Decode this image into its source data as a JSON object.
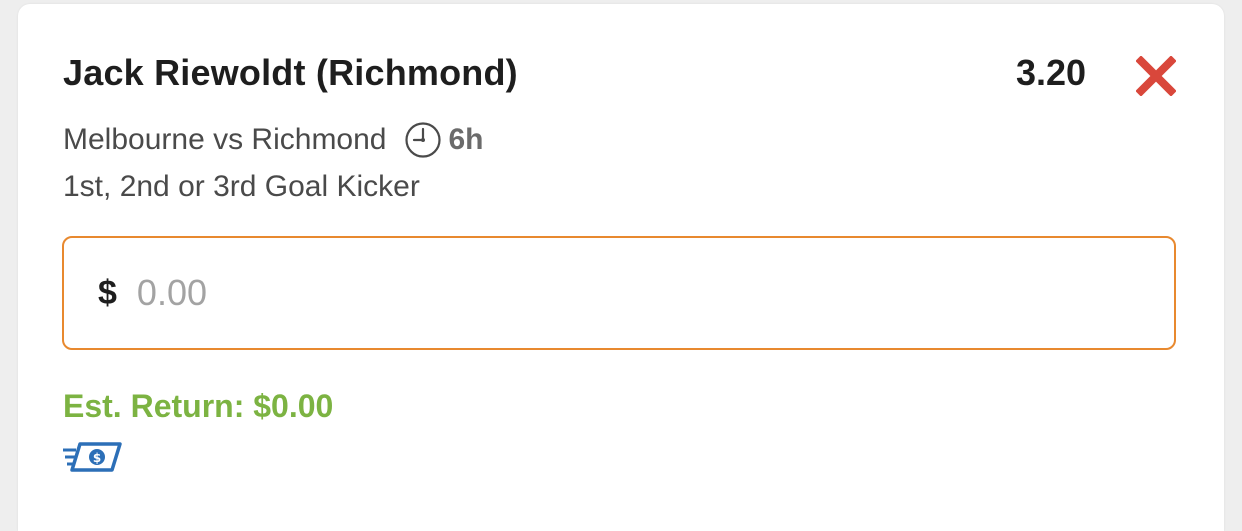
{
  "bet": {
    "selection": "Jack Riewoldt (Richmond)",
    "odds": "3.20",
    "match": "Melbourne vs Richmond",
    "time_to_start": "6h",
    "market": "1st, 2nd or 3rd Goal Kicker"
  },
  "stake": {
    "currency_symbol": "$",
    "value": "",
    "placeholder": "0.00"
  },
  "est_return": {
    "text": "Est. Return: $0.00"
  },
  "icons": {
    "remove": "close-icon",
    "start_time": "clock-icon",
    "cash_out": "cash-out-icon"
  },
  "colors": {
    "remove": "#d9473b",
    "input_border": "#e8892f",
    "est_return": "#7cb342",
    "cash_icon": "#2c6fb7"
  }
}
